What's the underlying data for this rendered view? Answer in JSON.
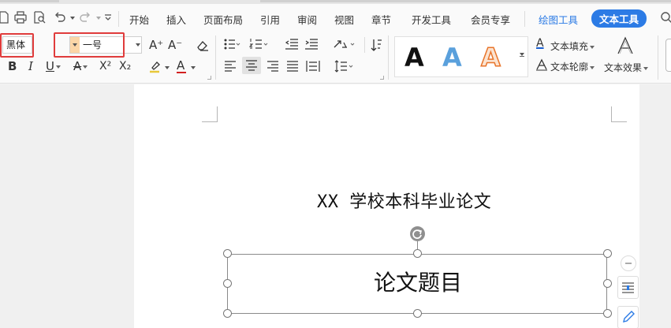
{
  "menu": {
    "items": [
      {
        "key": "start",
        "label": "开始"
      },
      {
        "key": "insert",
        "label": "插入"
      },
      {
        "key": "layout",
        "label": "页面布局"
      },
      {
        "key": "reference",
        "label": "引用"
      },
      {
        "key": "review",
        "label": "审阅"
      },
      {
        "key": "view",
        "label": "视图"
      },
      {
        "key": "chapter",
        "label": "章节"
      },
      {
        "key": "devtools",
        "label": "开发工具"
      },
      {
        "key": "member",
        "label": "会员专享"
      },
      {
        "key": "drawtools",
        "label": "绘图工具"
      },
      {
        "key": "texttools",
        "label": "文本工具"
      }
    ],
    "active": "文本工具",
    "quick_access_icons": [
      "print-icon",
      "print-preview-icon",
      "undo-icon",
      "redo-icon",
      "customize-icon"
    ]
  },
  "ribbon": {
    "font_name": "黑体",
    "font_size": "一号",
    "text_fill_label": "文本填充",
    "text_outline_label": "文本轮廓",
    "text_effect_label": "文本效果",
    "style_gallery_letters": [
      "A",
      "A",
      "A"
    ],
    "format_buttons": {
      "bold": "B",
      "italic": "I",
      "underline": "U",
      "strikethrough": "A",
      "superscript": "X²",
      "subscript": "X₂",
      "font_color": "A",
      "grow_font": "A⁺",
      "shrink_font": "A⁻"
    }
  },
  "document": {
    "title": "XX 学校本科毕业论文",
    "textbox_text": "论文题目"
  },
  "colors": {
    "accent": "#2c7be5",
    "highlight_box": "#e03c3c",
    "font_color_underline": "#d22020",
    "fill_underline": "#1a5fd0"
  }
}
